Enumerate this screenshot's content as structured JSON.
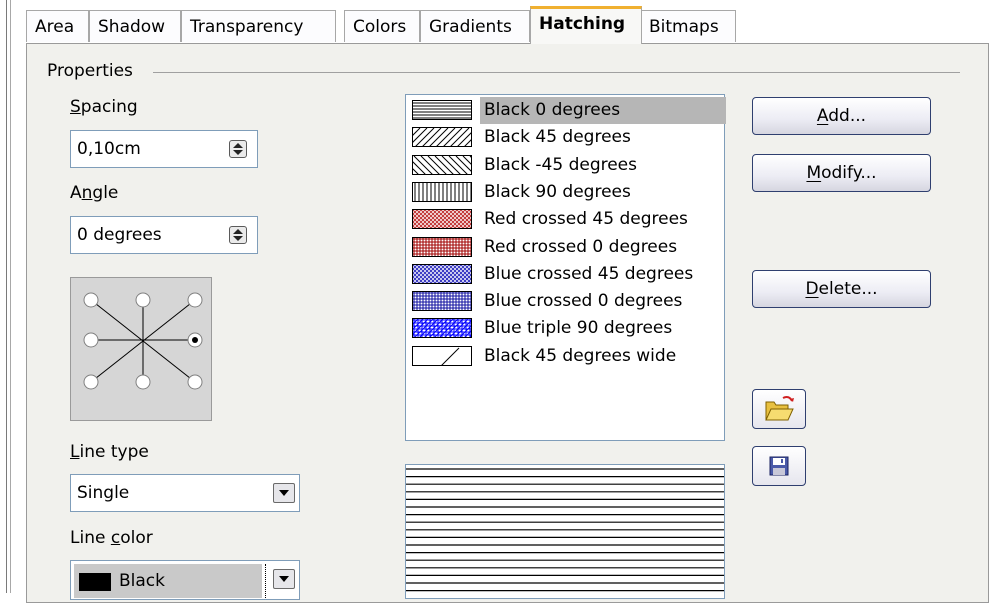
{
  "tabs": [
    {
      "label": "Area"
    },
    {
      "label": "Shadow"
    },
    {
      "label": "Transparency"
    },
    {
      "label": "Colors"
    },
    {
      "label": "Gradients"
    },
    {
      "label": "Hatching",
      "active": true
    },
    {
      "label": "Bitmaps"
    }
  ],
  "properties": {
    "group_title": "Properties",
    "spacing_label_u": "S",
    "spacing_label_rest": "pacing",
    "spacing_value": "0,10cm",
    "angle_label_pre": "A",
    "angle_label_u": "n",
    "angle_label_rest": "gle",
    "angle_value": "0 degrees",
    "line_type_label_u": "L",
    "line_type_label_rest": "ine type",
    "line_type_value": "Single",
    "line_color_label_pre": "Line ",
    "line_color_label_u": "c",
    "line_color_label_rest": "olor",
    "line_color_value": "Black",
    "line_color_swatch": "#000000"
  },
  "hatch_list": [
    {
      "label": "Black 0 degrees",
      "selected": true,
      "pattern": "lines-0",
      "color": "#000000"
    },
    {
      "label": "Black 45 degrees",
      "pattern": "lines-45",
      "color": "#000000"
    },
    {
      "label": "Black -45 degrees",
      "pattern": "lines-m45",
      "color": "#000000"
    },
    {
      "label": "Black 90 degrees",
      "pattern": "lines-90",
      "color": "#000000"
    },
    {
      "label": "Red crossed 45 degrees",
      "pattern": "cross-45",
      "color": "#c03030"
    },
    {
      "label": "Red crossed 0 degrees",
      "pattern": "cross-0",
      "color": "#a00000"
    },
    {
      "label": "Blue crossed 45 degrees",
      "pattern": "cross-45",
      "color": "#3030c0"
    },
    {
      "label": "Blue crossed 0 degrees",
      "pattern": "cross-0",
      "color": "#1010a0"
    },
    {
      "label": "Blue triple 90 degrees",
      "pattern": "triple",
      "color": "#0000ff"
    },
    {
      "label": "Black 45 degrees wide",
      "pattern": "wide-45",
      "color": "#000000"
    }
  ],
  "buttons": {
    "add_u": "A",
    "add_rest": "dd...",
    "modify_u": "M",
    "modify_rest": "odify...",
    "delete_u": "D",
    "delete_rest": "elete..."
  },
  "icons": {
    "load": "open-folder-icon",
    "save": "floppy-save-icon"
  },
  "angle_selector": {
    "positions": [
      "top-left",
      "top",
      "top-right",
      "left",
      "right",
      "bottom-left",
      "bottom",
      "bottom-right"
    ],
    "selected": "right"
  }
}
